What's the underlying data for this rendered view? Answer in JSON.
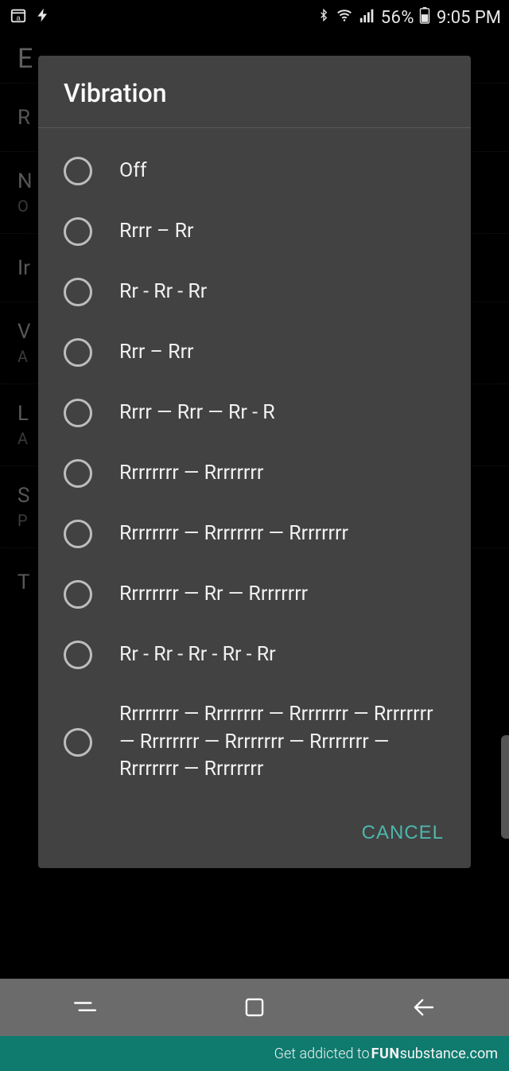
{
  "status": {
    "battery_pct": "56%",
    "time": "9:05 PM"
  },
  "background": {
    "header_letter": "E",
    "items": [
      {
        "title_initial": "R",
        "sub": ""
      },
      {
        "title_initial": "N",
        "sub": "O"
      },
      {
        "title_initial": "Ir",
        "sub": ""
      },
      {
        "title_initial": "V",
        "sub": "A"
      },
      {
        "title_initial": "L",
        "sub": "A"
      },
      {
        "title_initial": "S",
        "sub": "P"
      },
      {
        "title_initial": "T",
        "sub": ""
      }
    ]
  },
  "dialog": {
    "title": "Vibration",
    "options": [
      "Off",
      "Rrrr – Rr",
      "Rr - Rr - Rr",
      "Rrr – Rrr",
      "Rrrr — Rrr — Rr - R",
      "Rrrrrrrr — Rrrrrrrr",
      "Rrrrrrrr — Rrrrrrrr — Rrrrrrrr",
      "Rrrrrrrr — Rr — Rrrrrrrr",
      "Rr - Rr - Rr - Rr - Rr",
      "Rrrrrrrr — Rrrrrrrr — Rrrrrrrr — Rrrrrrrr — Rrrrrrrr — Rrrrrrrr — Rrrrrrrr — Rrrrrrrr — Rrrrrrrr"
    ],
    "cancel_label": "CANCEL"
  },
  "footer": {
    "prefix": "Get addicted to ",
    "brand_bold": "FUN",
    "brand_rest": "substance",
    "suffix": ".com"
  }
}
